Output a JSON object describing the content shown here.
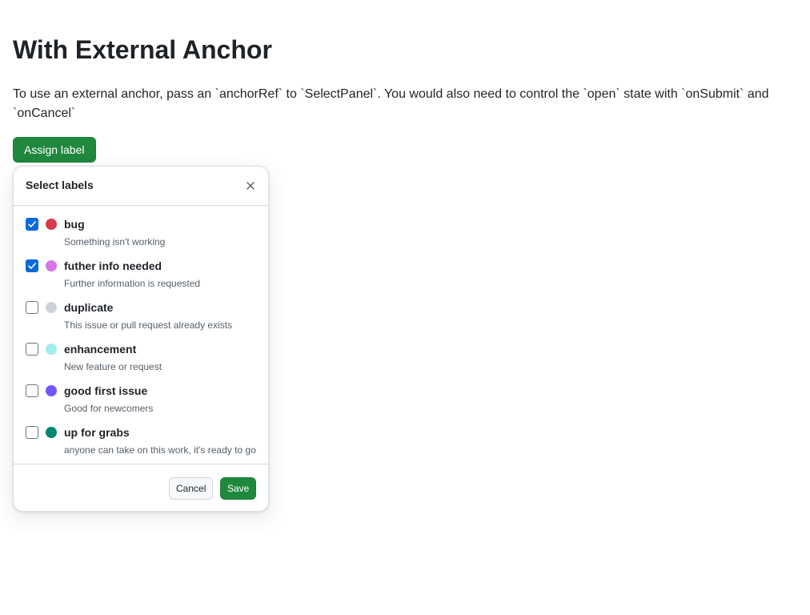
{
  "page": {
    "title": "With External Anchor",
    "description": "To use an external anchor, pass an `anchorRef` to `SelectPanel`. You would also need to control the `open` state with `onSubmit` and `onCancel`"
  },
  "anchor_button": {
    "label": "Assign label"
  },
  "panel": {
    "title": "Select labels",
    "close_icon": "close-icon",
    "items": [
      {
        "label": "bug",
        "description": "Something isn't working",
        "color": "#d73a4a",
        "checked": true
      },
      {
        "label": "futher info needed",
        "description": "Further information is requested",
        "color": "#d876e3",
        "checked": true
      },
      {
        "label": "duplicate",
        "description": "This issue or pull request already exists",
        "color": "#cfd3d7",
        "checked": false
      },
      {
        "label": "enhancement",
        "description": "New feature or request",
        "color": "#a2eeef",
        "checked": false
      },
      {
        "label": "good first issue",
        "description": "Good for newcomers",
        "color": "#7057ff",
        "checked": false
      },
      {
        "label": "up for grabs",
        "description": "anyone can take on this work, it's ready to go",
        "color": "#008672",
        "checked": false
      }
    ],
    "cancel_label": "Cancel",
    "save_label": "Save"
  },
  "colors": {
    "primary_button": "#1f883d",
    "checkbox_checked": "#0969da"
  }
}
